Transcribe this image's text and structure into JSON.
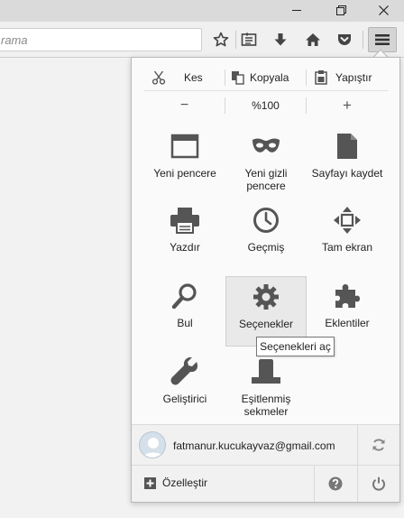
{
  "window": {
    "minimize_icon": "minimize-icon",
    "restore_icon": "restore-icon",
    "close_icon": "close-icon"
  },
  "toolbar": {
    "search_placeholder": "rama"
  },
  "edit": {
    "cut": "Kes",
    "copy": "Kopyala",
    "paste": "Yapıştır"
  },
  "zoom": {
    "out": "−",
    "level": "%100",
    "in": "+"
  },
  "items": [
    {
      "label": "Yeni pencere"
    },
    {
      "label": "Yeni gizli pencere"
    },
    {
      "label": "Sayfayı kaydet"
    },
    {
      "label": "Yazdır"
    },
    {
      "label": "Geçmiş"
    },
    {
      "label": "Tam ekran"
    },
    {
      "label": "Bul"
    },
    {
      "label": "Seçenekler"
    },
    {
      "label": "Eklentiler"
    },
    {
      "label": "Geliştirici"
    },
    {
      "label": "Eşitlenmiş sekmeler"
    }
  ],
  "tooltip": "Seçenekleri aç",
  "account": {
    "email": "fatmanur.kucukayvaz@gmail.com"
  },
  "footer": {
    "customize": "Özelleştir"
  },
  "colors": {
    "icon": "#555555",
    "panel_bg": "#fafafa",
    "hover_bg": "#e9e9e9"
  }
}
